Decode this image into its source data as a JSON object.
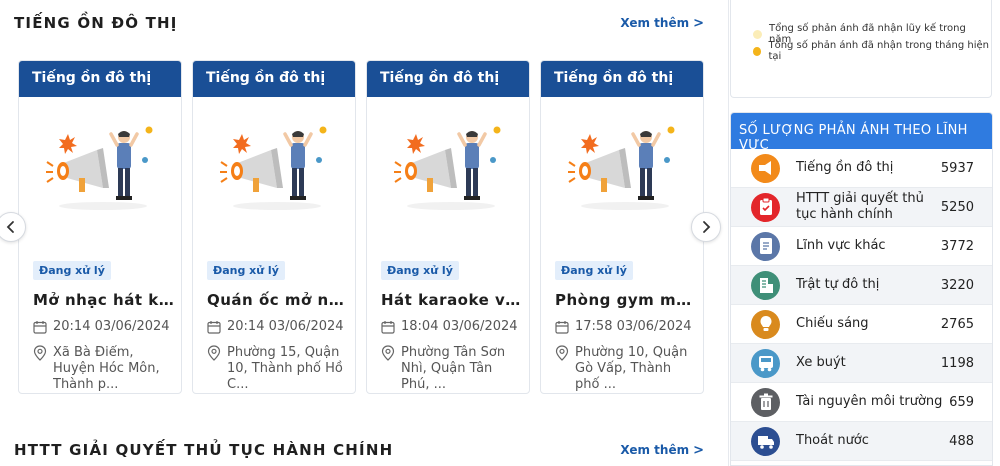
{
  "section1": {
    "title": "TIẾNG ỒN ĐÔ THỊ",
    "see_more": "Xem thêm",
    "see_more_icon": "chevron-right-icon"
  },
  "section2": {
    "title": "HTTT GIẢI QUYẾT THỦ TỤC HÀNH CHÍNH",
    "see_more": "Xem thêm"
  },
  "cards": [
    {
      "category": "Tiếng ồn đô thị",
      "status": "Đang xử lý",
      "title": "Mở nhạc hát karaoke",
      "time": "20:14 03/06/2024",
      "address": "Xã Bà Điểm, Huyện Hóc Môn, Thành p..."
    },
    {
      "category": "Tiếng ồn đô thị",
      "status": "Đang xử lý",
      "title": "Quán ốc mở nhạc lớn",
      "time": "20:14 03/06/2024",
      "address": "Phường 15, Quận 10, Thành phố Hồ C..."
    },
    {
      "category": "Tiếng ồn đô thị",
      "status": "Đang xử lý",
      "title": "Hát karaoke với loa",
      "time": "18:04 03/06/2024",
      "address": "Phường Tân Sơn Nhì, Quận Tân Phú, ..."
    },
    {
      "category": "Tiếng ồn đô thị",
      "status": "Đang xử lý",
      "title": "Phòng gym mở nhạc",
      "time": "17:58 03/06/2024",
      "address": "Phường 10, Quận Gò Vấp, Thành phố ..."
    }
  ],
  "legend": {
    "items": [
      {
        "label": "Tổng số phản ánh đã nhận lũy kế trong năm",
        "color": "#fbedb8"
      },
      {
        "label": "Tổng số phản ánh đã nhận trong tháng hiện tại",
        "color": "#f4b41a"
      }
    ]
  },
  "stats": {
    "title": "SỐ LƯỢNG PHẢN ÁNH THEO LĨNH VỰC",
    "rows": [
      {
        "label": "Tiếng ồn đô thị",
        "count": "5937",
        "icon": "megaphone-icon",
        "color": "#f28a1a"
      },
      {
        "label": "HTTT giải quyết thủ tục hành chính",
        "count": "5250",
        "icon": "clipboard-icon",
        "color": "#e3262b"
      },
      {
        "label": "Lĩnh vực khác",
        "count": "3772",
        "icon": "document-icon",
        "color": "#5b77a8"
      },
      {
        "label": "Trật tự đô thị",
        "count": "3220",
        "icon": "building-icon",
        "color": "#3f8f78"
      },
      {
        "label": "Chiếu sáng",
        "count": "2765",
        "icon": "lightbulb-icon",
        "color": "#d98a1e"
      },
      {
        "label": "Xe buýt",
        "count": "1198",
        "icon": "bus-icon",
        "color": "#4a98c8"
      },
      {
        "label": "Tài nguyên môi trường",
        "count": "659",
        "icon": "trash-icon",
        "color": "#5d5f63"
      },
      {
        "label": "Thoát nước",
        "count": "488",
        "icon": "truck-icon",
        "color": "#2c4e92"
      }
    ]
  }
}
